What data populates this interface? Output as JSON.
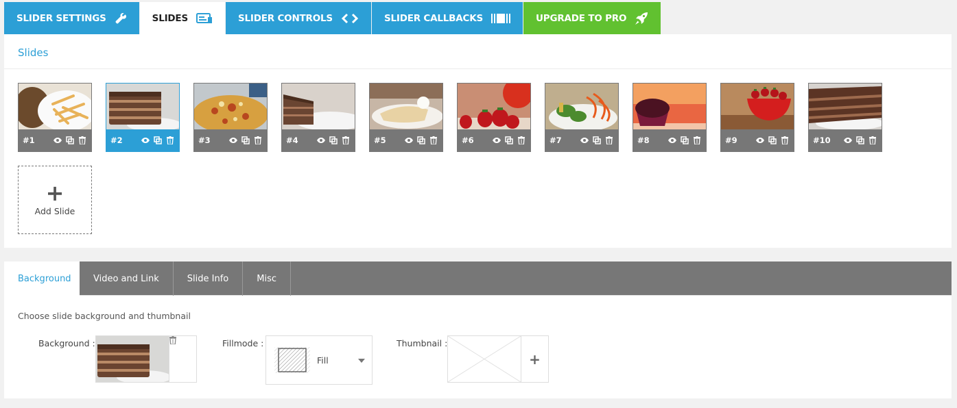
{
  "top_tabs": [
    {
      "label": "SLIDER SETTINGS",
      "icon": "wrench-icon"
    },
    {
      "label": "SLIDES",
      "icon": "slides-icon"
    },
    {
      "label": "SLIDER CONTROLS",
      "icon": "code-arrows-icon"
    },
    {
      "label": "SLIDER CALLBACKS",
      "icon": "barcode-icon"
    },
    {
      "label": "UPGRADE TO PRO",
      "icon": "rocket-icon"
    }
  ],
  "slides_panel": {
    "title": "Slides",
    "slides": [
      {
        "number": "#1",
        "subject": "french fries"
      },
      {
        "number": "#2",
        "subject": "chocolate cake",
        "selected": true
      },
      {
        "number": "#3",
        "subject": "pizza"
      },
      {
        "number": "#4",
        "subject": "cake slice"
      },
      {
        "number": "#5",
        "subject": "crepe"
      },
      {
        "number": "#6",
        "subject": "strawberries"
      },
      {
        "number": "#7",
        "subject": "salad"
      },
      {
        "number": "#8",
        "subject": "muffin"
      },
      {
        "number": "#9",
        "subject": "strawberry bowl"
      },
      {
        "number": "#10",
        "subject": "layer cake"
      }
    ],
    "add_slide_label": "Add Slide",
    "add_slide_symbol": "+"
  },
  "bottom_panel": {
    "tabs": [
      "Background",
      "Video and Link",
      "Slide Info",
      "Misc"
    ],
    "description": "Choose slide background and thumbnail",
    "background_label": "Background :",
    "fillmode_label": "Fillmode :",
    "fillmode_value": "Fill",
    "thumbnail_label": "Thumbnail :",
    "thumbnail_add_symbol": "+"
  },
  "colors": {
    "accent": "#2c9fd6",
    "pro": "#61c130",
    "tab_gray": "#777777"
  }
}
